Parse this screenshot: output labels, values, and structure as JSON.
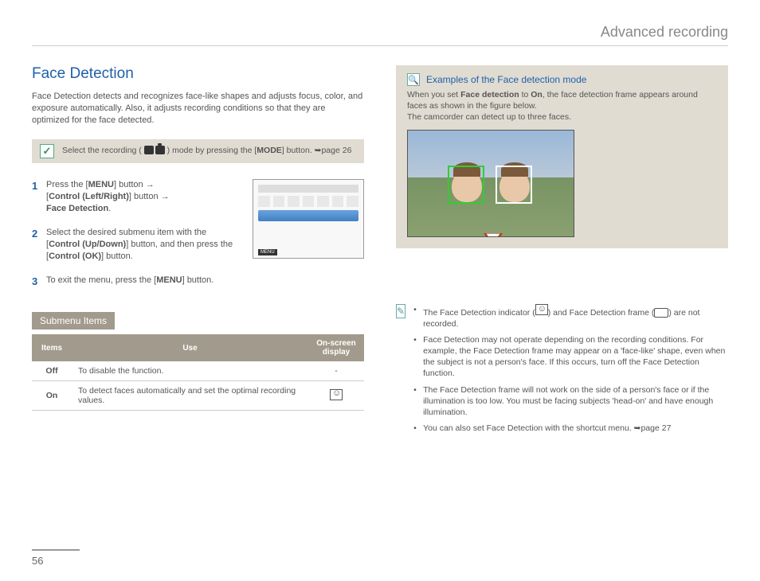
{
  "header": {
    "title": "Advanced recording"
  },
  "section": {
    "title": "Face Detection",
    "intro": "Face Detection detects and recognizes face-like shapes and adjusts focus, color, and exposure automatically. Also, it adjusts recording conditions so that they are optimized for the face detected."
  },
  "mode_note": {
    "pre": "Select the recording (",
    "post": ") mode by pressing the [",
    "btn": "MODE",
    "tail": "] button. ➥page 26"
  },
  "steps": {
    "s1a": "Press the [",
    "s1menu": "MENU",
    "s1b": "] button →",
    "s1c": "[",
    "s1ctrl": "Control (Left/Right)",
    "s1d": "] button →",
    "s1e": "Face Detection",
    "s1f": ".",
    "s2a": "Select the desired submenu item with the [",
    "s2ctrl": "Control (Up/Down)",
    "s2b": "] button, and then press the [",
    "s2ok": "Control (OK)",
    "s2c": "] button.",
    "s3a": "To exit the menu, press the [",
    "s3menu": "MENU",
    "s3b": "] button."
  },
  "submenu": {
    "label": "Submenu Items",
    "col1": "Items",
    "col2": "Use",
    "col3": "On-screen display",
    "row1": {
      "item": "Off",
      "use": "To disable the function.",
      "disp": "-"
    },
    "row2": {
      "item": "On",
      "use": "To detect faces automatically and set the optimal recording values."
    }
  },
  "example": {
    "title": "Examples of the Face detection mode",
    "body_a": "When you set ",
    "body_b": "Face detection",
    "body_c": " to ",
    "body_d": "On",
    "body_e": ", the face detection frame appears around faces as shown in the figure below.",
    "body_f": "The camcorder can detect up to three faces."
  },
  "tips": {
    "t1a": "The Face Detection indicator (",
    "t1b": ") and Face Detection frame (",
    "t1c": ") are not recorded.",
    "t2": "Face Detection may not operate depending on the recording conditions. For example, the Face Detection frame may appear on a 'face-like' shape, even when the subject is not a person's face. If this occurs, turn off the Face Detection function.",
    "t3": "The Face Detection frame will not work on the side of a person's face or if the illumination is too low. You must be facing subjects 'head-on' and have enough illumination.",
    "t4": "You can also set Face Detection with the shortcut menu. ➥page 27"
  },
  "page_number": "56"
}
